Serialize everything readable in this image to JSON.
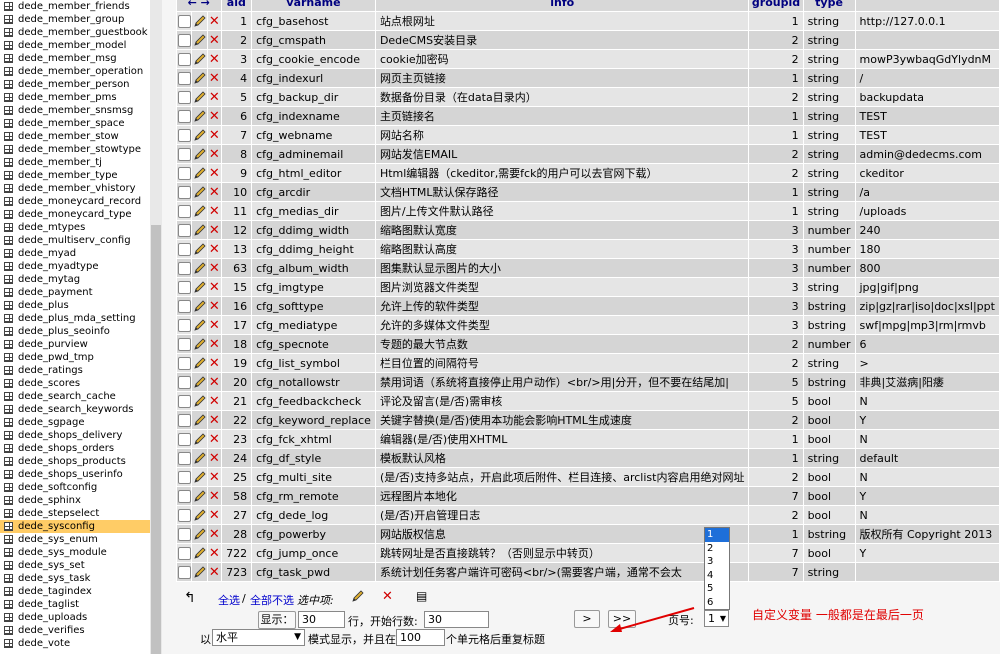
{
  "sidebar": {
    "items": [
      {
        "label": "dede_member_friends"
      },
      {
        "label": "dede_member_group"
      },
      {
        "label": "dede_member_guestbook"
      },
      {
        "label": "dede_member_model"
      },
      {
        "label": "dede_member_msg"
      },
      {
        "label": "dede_member_operation"
      },
      {
        "label": "dede_member_person"
      },
      {
        "label": "dede_member_pms"
      },
      {
        "label": "dede_member_snsmsg"
      },
      {
        "label": "dede_member_space"
      },
      {
        "label": "dede_member_stow"
      },
      {
        "label": "dede_member_stowtype"
      },
      {
        "label": "dede_member_tj"
      },
      {
        "label": "dede_member_type"
      },
      {
        "label": "dede_member_vhistory"
      },
      {
        "label": "dede_moneycard_record"
      },
      {
        "label": "dede_moneycard_type"
      },
      {
        "label": "dede_mtypes"
      },
      {
        "label": "dede_multiserv_config"
      },
      {
        "label": "dede_myad"
      },
      {
        "label": "dede_myadtype"
      },
      {
        "label": "dede_mytag"
      },
      {
        "label": "dede_payment"
      },
      {
        "label": "dede_plus"
      },
      {
        "label": "dede_plus_mda_setting"
      },
      {
        "label": "dede_plus_seoinfo"
      },
      {
        "label": "dede_purview"
      },
      {
        "label": "dede_pwd_tmp"
      },
      {
        "label": "dede_ratings"
      },
      {
        "label": "dede_scores"
      },
      {
        "label": "dede_search_cache"
      },
      {
        "label": "dede_search_keywords"
      },
      {
        "label": "dede_sgpage"
      },
      {
        "label": "dede_shops_delivery"
      },
      {
        "label": "dede_shops_orders"
      },
      {
        "label": "dede_shops_products"
      },
      {
        "label": "dede_shops_userinfo"
      },
      {
        "label": "dede_softconfig"
      },
      {
        "label": "dede_sphinx"
      },
      {
        "label": "dede_stepselect"
      },
      {
        "label": "dede_sysconfig",
        "active": true
      },
      {
        "label": "dede_sys_enum"
      },
      {
        "label": "dede_sys_module"
      },
      {
        "label": "dede_sys_set"
      },
      {
        "label": "dede_sys_task"
      },
      {
        "label": "dede_tagindex"
      },
      {
        "label": "dede_taglist"
      },
      {
        "label": "dede_uploads"
      },
      {
        "label": "dede_verifies"
      },
      {
        "label": "dede_vote"
      }
    ]
  },
  "table": {
    "headers": {
      "aid": "aid",
      "varname": "varname",
      "info": "info",
      "groupid": "groupid",
      "type": "type"
    },
    "rows": [
      [
        "1",
        "cfg_basehost",
        "站点根网址",
        "1",
        "string",
        "http://127.0.0.1"
      ],
      [
        "2",
        "cfg_cmspath",
        "DedeCMS安装目录",
        "2",
        "string",
        ""
      ],
      [
        "3",
        "cfg_cookie_encode",
        "cookie加密码",
        "2",
        "string",
        "mowP3ywbaqGdYlydnM"
      ],
      [
        "4",
        "cfg_indexurl",
        "网页主页链接",
        "1",
        "string",
        "/"
      ],
      [
        "5",
        "cfg_backup_dir",
        "数据备份目录（在data目录内）",
        "2",
        "string",
        "backupdata"
      ],
      [
        "6",
        "cfg_indexname",
        "主页链接名",
        "1",
        "string",
        "TEST"
      ],
      [
        "7",
        "cfg_webname",
        "网站名称",
        "1",
        "string",
        "TEST"
      ],
      [
        "8",
        "cfg_adminemail",
        "网站发信EMAIL",
        "2",
        "string",
        "admin@dedecms.com"
      ],
      [
        "9",
        "cfg_html_editor",
        "Html编辑器（ckeditor,需要fck的用户可以去官网下载）",
        "2",
        "string",
        "ckeditor"
      ],
      [
        "10",
        "cfg_arcdir",
        "文档HTML默认保存路径",
        "1",
        "string",
        "/a"
      ],
      [
        "11",
        "cfg_medias_dir",
        "图片/上传文件默认路径",
        "1",
        "string",
        "/uploads"
      ],
      [
        "12",
        "cfg_ddimg_width",
        "缩略图默认宽度",
        "3",
        "number",
        "240"
      ],
      [
        "13",
        "cfg_ddimg_height",
        "缩略图默认高度",
        "3",
        "number",
        "180"
      ],
      [
        "63",
        "cfg_album_width",
        "图集默认显示图片的大小",
        "3",
        "number",
        "800"
      ],
      [
        "15",
        "cfg_imgtype",
        "图片浏览器文件类型",
        "3",
        "string",
        "jpg|gif|png"
      ],
      [
        "16",
        "cfg_softtype",
        "允许上传的软件类型",
        "3",
        "bstring",
        "zip|gz|rar|iso|doc|xsl|ppt"
      ],
      [
        "17",
        "cfg_mediatype",
        "允许的多媒体文件类型",
        "3",
        "bstring",
        "swf|mpg|mp3|rm|rmvb"
      ],
      [
        "18",
        "cfg_specnote",
        "专题的最大节点数",
        "2",
        "number",
        "6"
      ],
      [
        "19",
        "cfg_list_symbol",
        "栏目位置的间隔符号",
        "2",
        "string",
        ">"
      ],
      [
        "20",
        "cfg_notallowstr",
        "禁用词语（系统将直接停止用户动作）<br/>用|分开，但不要在结尾加|",
        "5",
        "bstring",
        "非典|艾滋病|阳痿"
      ],
      [
        "21",
        "cfg_feedbackcheck",
        "评论及留言(是/否)需审核",
        "5",
        "bool",
        "N"
      ],
      [
        "22",
        "cfg_keyword_replace",
        "关键字替换(是/否)使用本功能会影响HTML生成速度",
        "2",
        "bool",
        "Y"
      ],
      [
        "23",
        "cfg_fck_xhtml",
        "编辑器(是/否)使用XHTML",
        "1",
        "bool",
        "N"
      ],
      [
        "24",
        "cfg_df_style",
        "模板默认风格",
        "1",
        "string",
        "default"
      ],
      [
        "25",
        "cfg_multi_site",
        "(是/否)支持多站点，开启此项后附件、栏目连接、arclist内容启用绝对网址",
        "2",
        "bool",
        "N"
      ],
      [
        "58",
        "cfg_rm_remote",
        "远程图片本地化",
        "7",
        "bool",
        "Y"
      ],
      [
        "27",
        "cfg_dede_log",
        "(是/否)开启管理日志",
        "2",
        "bool",
        "N"
      ],
      [
        "28",
        "cfg_powerby",
        "网站版权信息",
        "1",
        "bstring",
        "版权所有 Copyright 2013"
      ],
      [
        "722",
        "cfg_jump_once",
        "跳转网址是否直接跳转？（否则显示中转页）",
        "7",
        "bool",
        "Y"
      ],
      [
        "723",
        "cfg_task_pwd",
        "系统计划任务客户端许可密码<br/>(需要客户端，通常不会太",
        "7",
        "string",
        ""
      ]
    ]
  },
  "footer": {
    "select_all": "全选",
    "select_none": "全部不选",
    "with_selected": "选中项:",
    "show_label": "显示：",
    "show_value": "30",
    "rows_label": "行，开始行数:",
    "start_value": "30",
    "mode_prefix": "以",
    "mode_value": "水平",
    "mode_suffix": "模式显示，并且在",
    "repeat_value": "100",
    "repeat_suffix": "个单元格后重复标题",
    "next_label": ">",
    "last_label": ">>",
    "page_label": "页号:",
    "page_value": "1",
    "page_options": [
      "1",
      "2",
      "3",
      "4",
      "5",
      "6"
    ]
  },
  "annotation": "自定义变量 一般都是在最后一页",
  "colors": {
    "accent": "#1e6fd9",
    "annotation": "#e00000",
    "delete": "#d00000",
    "header_text": "#000080"
  }
}
